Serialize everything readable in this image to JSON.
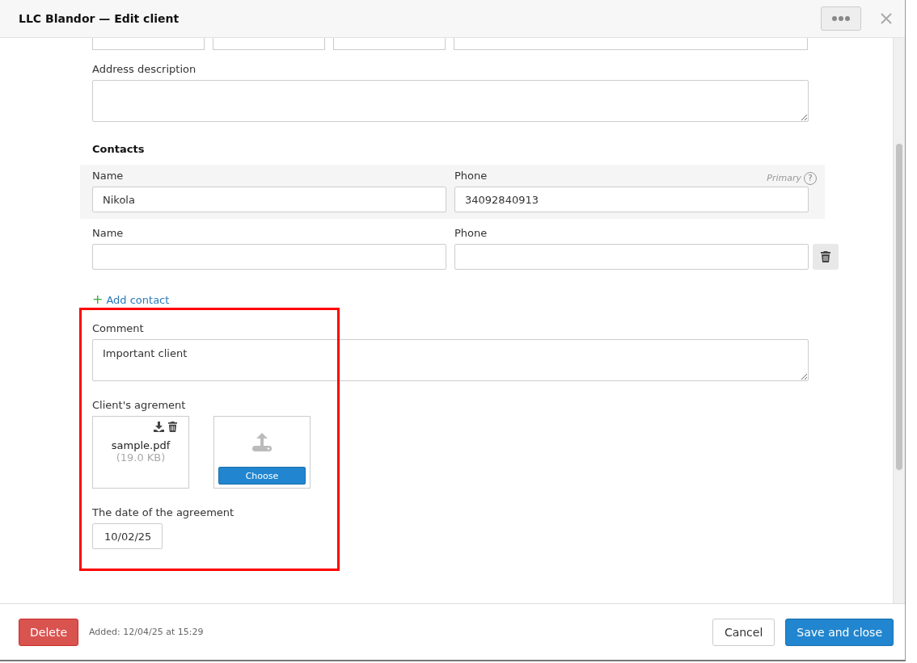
{
  "window": {
    "title": "LLC Blandor — Edit client"
  },
  "address_description": {
    "label": "Address description"
  },
  "contacts": {
    "title": "Contacts",
    "primary_label": "Primary",
    "help": "?",
    "rows": [
      {
        "kind": "primary",
        "name_label": "Name",
        "name": "Nikola",
        "phone_label": "Phone",
        "phone": "34092840913"
      },
      {
        "kind": "extra",
        "name_label": "Name",
        "name": "",
        "phone_label": "Phone",
        "phone": ""
      }
    ],
    "add": {
      "icon": "+",
      "label": "Add contact"
    }
  },
  "comment": {
    "label": "Comment",
    "value": "Important client"
  },
  "agreement": {
    "label": "Client's agrement",
    "file": {
      "name": "sample.pdf",
      "size": "(19.0 KB)"
    },
    "choose": "Choose"
  },
  "agreement_date": {
    "label": "The date of the agreement",
    "value": "10/02/25"
  },
  "footer": {
    "delete": "Delete",
    "added": "Added: 12/04/25 at 15:29",
    "cancel": "Cancel",
    "save": "Save and close"
  }
}
